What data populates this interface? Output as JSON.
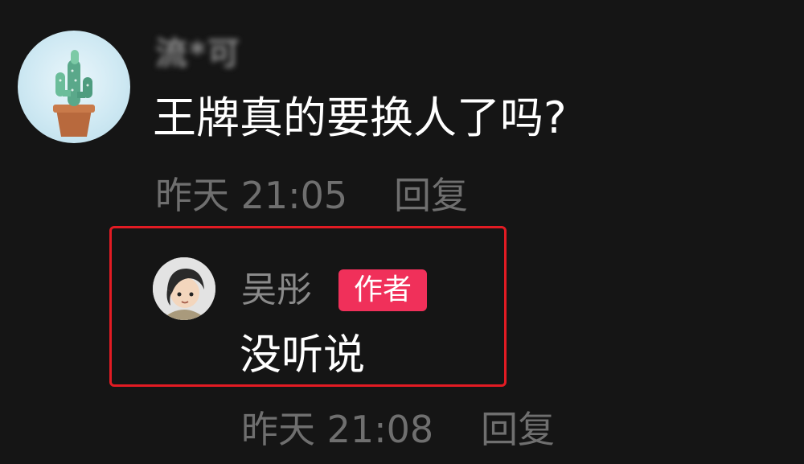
{
  "comment": {
    "username": "流*可",
    "text": "王牌真的要换人了吗?",
    "timestamp": "昨天 21:05",
    "reply_label": "回复",
    "avatar_icon": "cactus-avatar-icon"
  },
  "reply": {
    "username": "吴彤",
    "badge": "作者",
    "text": "没听说",
    "timestamp": "昨天 21:08",
    "reply_label": "回复",
    "avatar_icon": "cartoon-person-avatar-icon"
  },
  "colors": {
    "background": "#151515",
    "primary_text": "#ffffff",
    "secondary_text": "#6f6f6f",
    "username_text": "#8a8a8a",
    "badge_background": "#f0305a",
    "highlight_border": "#e21b23"
  }
}
